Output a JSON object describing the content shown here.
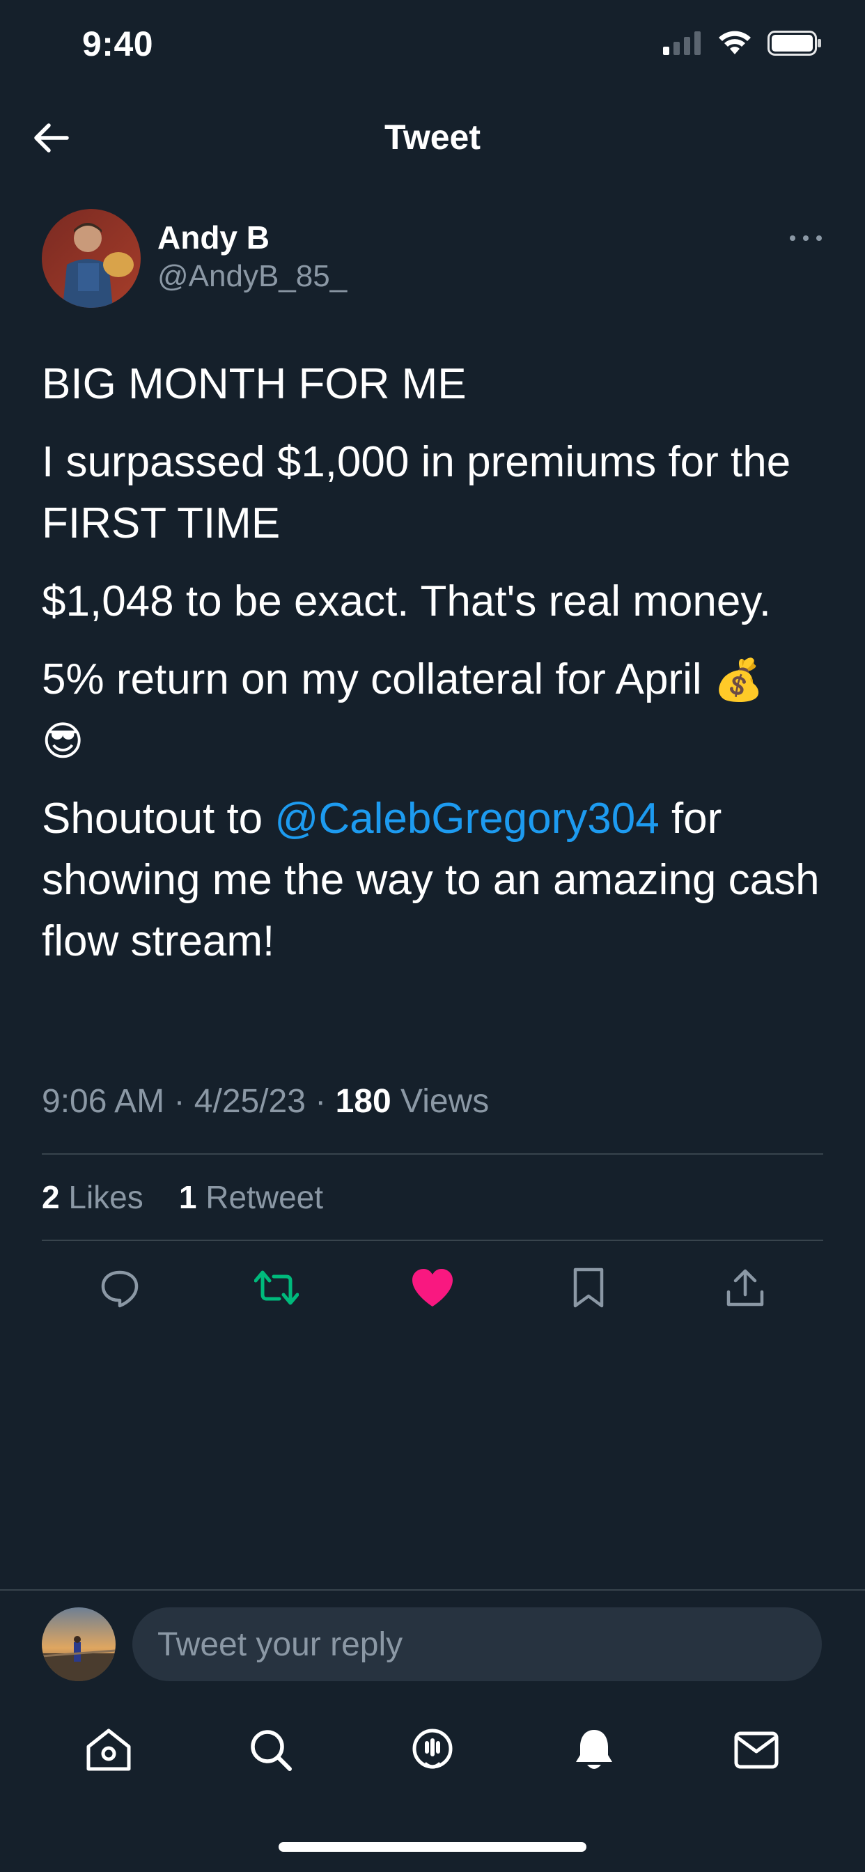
{
  "status_bar": {
    "time": "9:40",
    "icons": [
      "cellular-signal-icon",
      "wifi-icon",
      "battery-icon"
    ]
  },
  "header": {
    "title": "Tweet",
    "back_icon": "arrow-left-icon"
  },
  "author": {
    "name": "Andy B",
    "handle": "@AndyB_85_"
  },
  "tweet": {
    "line1": "BIG MONTH FOR ME",
    "line2": "I surpassed $1,000 in premiums for the FIRST TIME",
    "line3": "$1,048 to be exact. That's real money.",
    "line4_text": "5% return on my collateral for April",
    "line4_emoji1": "💰",
    "line4_emoji2": "😎",
    "line5_pre": "Shoutout to ",
    "line5_mention": "@CalebGregory304",
    "line5_post": " for showing me the way to an amazing cash flow stream!"
  },
  "meta": {
    "time": "9:06 AM",
    "date": "4/25/23",
    "views_count": "180",
    "views_label": "Views",
    "sep": "·"
  },
  "stats": {
    "likes_count": "2",
    "likes_label": "Likes",
    "retweets_count": "1",
    "retweets_label": "Retweet"
  },
  "actions": [
    {
      "icon": "reply-icon"
    },
    {
      "icon": "retweet-icon",
      "active": true,
      "color": "#00ba7c"
    },
    {
      "icon": "heart-icon",
      "active": true,
      "color": "#f91880"
    },
    {
      "icon": "bookmark-icon"
    },
    {
      "icon": "share-icon"
    }
  ],
  "reply": {
    "placeholder": "Tweet your reply"
  },
  "bottom_nav": [
    "home-icon",
    "search-icon",
    "spaces-icon",
    "notifications-icon",
    "messages-icon"
  ],
  "colors": {
    "background": "#15202b",
    "accent": "#1d9bf0",
    "muted": "#8b98a5",
    "divider": "#38444d"
  }
}
